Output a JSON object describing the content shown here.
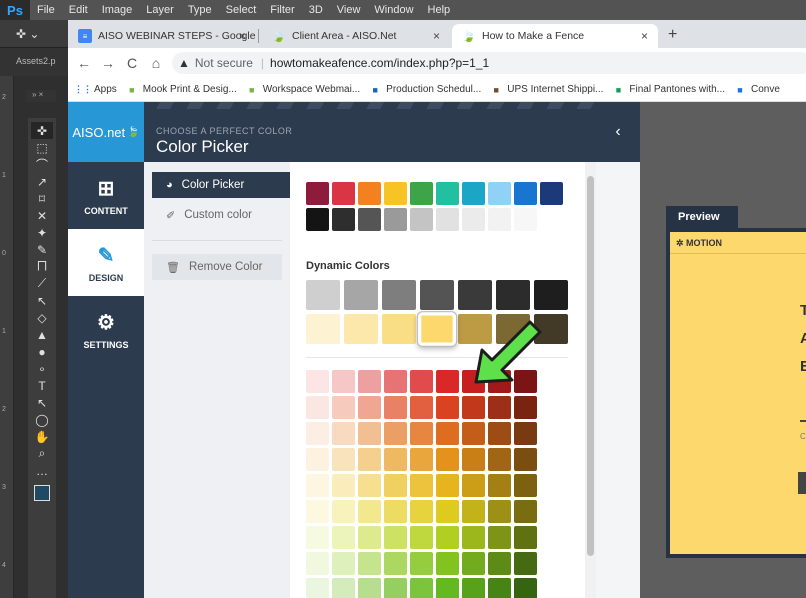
{
  "photoshop": {
    "logo": "Ps",
    "menu": [
      "File",
      "Edit",
      "Image",
      "Layer",
      "Type",
      "Select",
      "Filter",
      "3D",
      "View",
      "Window",
      "Help"
    ],
    "options_icon": "move-tool-icon",
    "doc_tab": "Assets2.p",
    "panel_head": "» ×",
    "ruler_numbers": [
      "2",
      "1",
      "0",
      "1",
      "2",
      "3",
      "4"
    ],
    "tools": [
      "✜",
      "⬚",
      "⌒",
      "↗",
      "⌑",
      "✕",
      "✦",
      "✎",
      "⨅",
      "⟋",
      "↖",
      "◇",
      "▲",
      "●",
      "∘",
      "T",
      "↖",
      "◯",
      "✋",
      "⌕",
      "…"
    ],
    "foreground_color": "#1f4a63"
  },
  "browser": {
    "tabs": [
      {
        "title": "AISO WEBINAR STEPS - Google",
        "icon": "google-docs-icon",
        "close": "×"
      },
      {
        "title": "Client Area - AISO.Net",
        "icon": "aiso-leaf-icon",
        "close": "×"
      },
      {
        "title": "How to Make a Fence",
        "icon": "aiso-leaf-icon",
        "close": "×"
      }
    ],
    "new_tab": "+",
    "nav": {
      "back": "←",
      "forward": "→",
      "reload": "C",
      "home": "⌂"
    },
    "not_secure": "Not secure",
    "url": "howtomakeafence.com/index.php?p=1_1",
    "bookmarks": [
      {
        "label": "Apps",
        "icon": "apps-grid-icon",
        "color": "#1a73e8"
      },
      {
        "label": "Mook Print & Desig...",
        "icon": "leaf-icon",
        "color": "#7cb342"
      },
      {
        "label": "Workspace Webmai...",
        "icon": "workspace-icon",
        "color": "#7cb342"
      },
      {
        "label": "Production Schedul...",
        "icon": "trello-icon",
        "color": "#1565c0"
      },
      {
        "label": "UPS Internet Shippi...",
        "icon": "ups-icon",
        "color": "#6d4c2f"
      },
      {
        "label": "Final Pantones with...",
        "icon": "sheets-plus-icon",
        "color": "#0f9d58"
      },
      {
        "label": "Conve",
        "icon": "c-logo-icon",
        "color": "#1a73e8"
      }
    ]
  },
  "app": {
    "brand": "AISO.net",
    "sidebar": [
      {
        "label": "CONTENT",
        "icon": "plus-square-icon",
        "glyph": "⊞",
        "active": false
      },
      {
        "label": "DESIGN",
        "icon": "paintbrush-icon",
        "glyph": "🖌",
        "active": true
      },
      {
        "label": "SETTINGS",
        "icon": "gears-icon",
        "glyph": "⚙",
        "active": false
      }
    ],
    "eyebrow": "CHOOSE A PERFECT COLOR",
    "title": "Color Picker",
    "collapse": "‹",
    "subnav": {
      "color_picker": "Color Picker",
      "custom_color": "Custom color",
      "remove_color": "Remove Color"
    },
    "dynamic_label": "Dynamic Colors",
    "preview_tab": "Preview",
    "preview_brand": "✲ MOTION",
    "preview_letters": [
      "T",
      "A",
      "E"
    ],
    "preview_small": "C"
  },
  "palette": {
    "basic_row1": [
      "#8e1b3c",
      "#d93545",
      "#f48120",
      "#f7c325",
      "#3ea449",
      "#22bfa0",
      "#1ba6c6",
      "#8fd2f5",
      "#1876d1",
      "#1c3a7a"
    ],
    "basic_row2": [
      "#141414",
      "#2e2e2e",
      "#555555",
      "#9a9a9a",
      "#c4c4c4",
      "#e1e1e1",
      "#ebebeb",
      "#f2f2f2",
      "#f7f7f7",
      "#ffffff"
    ],
    "dynamic_row1": [
      "#cfcfcf",
      "#a6a6a6",
      "#7e7e7e",
      "#545454",
      "#3a3a3a",
      "#2c2c2c",
      "#1e1e1e"
    ],
    "dynamic_row2": [
      "#fdf3d3",
      "#fbe8aa",
      "#f9de86",
      "#fdd86d",
      "#bd9b45",
      "#7c6833",
      "#423a26"
    ],
    "selected": "#fdd86d",
    "gradient_rows": [
      [
        "#fbe5e5",
        "#f5c7c7",
        "#eea0a0",
        "#e77474",
        "#e24b4b",
        "#da2727",
        "#c51f1f",
        "#a11a1a",
        "#7b1414"
      ],
      [
        "#fbe7e1",
        "#f6cbbe",
        "#efa793",
        "#e88166",
        "#e2603f",
        "#da4321",
        "#c2381b",
        "#9d2e17",
        "#782411"
      ],
      [
        "#fceee2",
        "#f8dac0",
        "#f2bf95",
        "#ec9f65",
        "#e68640",
        "#de6d1f",
        "#c45d19",
        "#9d4c15",
        "#773a11"
      ],
      [
        "#fdf2e0",
        "#f9e3bc",
        "#f4cf8e",
        "#eeb961",
        "#e9a63c",
        "#e3921b",
        "#c97f16",
        "#a16613",
        "#7a4e10"
      ],
      [
        "#fdf6e0",
        "#faedbc",
        "#f6df8e",
        "#f1d062",
        "#edc33d",
        "#e7b41d",
        "#cc9e17",
        "#a47f14",
        "#7c6110"
      ],
      [
        "#fcf9e0",
        "#f8f2bc",
        "#f2e88e",
        "#ecdd62",
        "#e6d33e",
        "#decb20",
        "#c4b21a",
        "#9e8f16",
        "#786d11"
      ],
      [
        "#f6fae0",
        "#ecf4bc",
        "#ddeb8e",
        "#cde162",
        "#bfd83e",
        "#b0cf20",
        "#9bb71b",
        "#7d9416",
        "#5f7111"
      ],
      [
        "#f0f8e0",
        "#def0bc",
        "#c6e48e",
        "#acd862",
        "#96cd3e",
        "#82c320",
        "#72ab1b",
        "#5d8b16",
        "#466a11"
      ],
      [
        "#ebf6e0",
        "#d4ecbc",
        "#b6de8e",
        "#95cf62",
        "#7ac43e",
        "#62b920",
        "#56a31b",
        "#468416",
        "#356511"
      ]
    ]
  }
}
